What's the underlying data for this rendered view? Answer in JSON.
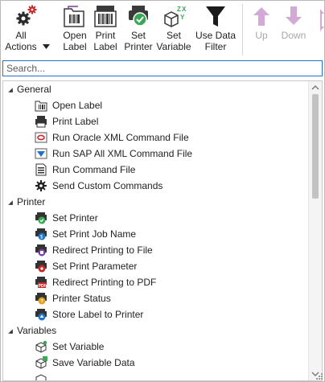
{
  "toolbar": {
    "all_actions": "All\nActions",
    "open_label": "Open\nLabel",
    "print_label": "Print\nLabel",
    "set_printer": "Set\nPrinter",
    "set_variable": "Set\nVariable",
    "use_data_filter": "Use Data\nFilter",
    "up": "Up",
    "down": "Down"
  },
  "search": {
    "placeholder": "Search..."
  },
  "tree": {
    "general": {
      "label": "General",
      "items": [
        "Open Label",
        "Print Label",
        "Run Oracle XML Command File",
        "Run SAP All XML Command File",
        "Run Command File",
        "Send Custom Commands"
      ]
    },
    "printer": {
      "label": "Printer",
      "items": [
        "Set Printer",
        "Set Print Job Name",
        "Redirect Printing to File",
        "Set Print Parameter",
        "Redirect Printing to PDF",
        "Printer Status",
        "Store Label to Printer"
      ]
    },
    "variables": {
      "label": "Variables",
      "items": [
        "Set Variable",
        "Save Variable Data"
      ]
    }
  },
  "colors": {
    "accent": "#1e74c8",
    "disabled": "#a8a8a8",
    "green": "#3aa757",
    "red": "#c62828"
  }
}
